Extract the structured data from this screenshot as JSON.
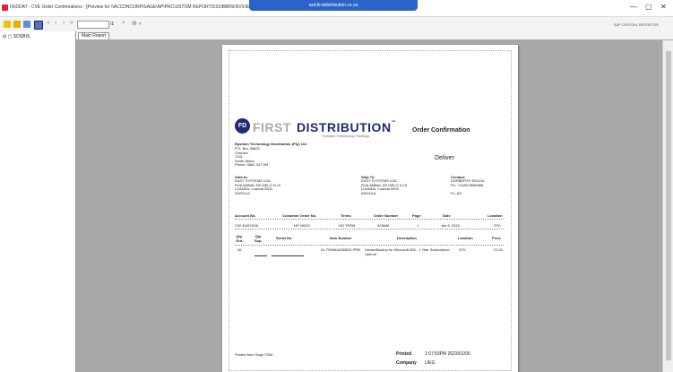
{
  "window": {
    "title": "FEDDAT - CVE Order Confirmations - [Preview for \\\\ACCDNCORP\\SAGE\\AP\\PRC\\USTOM REPORTS\\SOBBR\\ENV\\OECONF01.CPT]",
    "remote_title": "ssd.firstdistribution.co.za",
    "controls": {
      "minimize": "—",
      "maximize": "▢",
      "close": "✕"
    }
  },
  "toolbar": {
    "page_of": "/1",
    "sap_label": "SAP CRYSTAL REPORTS®"
  },
  "tree": {
    "root": "SOSBIS"
  },
  "tabs": [
    "Main Report"
  ],
  "report": {
    "logo": {
      "mark": "FD",
      "first": "FIRST",
      "dist": "DISTRIBUTION",
      "tm": "™",
      "sub": "Epsidon Technology Holdings"
    },
    "title": "Order Confirmation",
    "company": "Epsidon Technology Distribution (Pty) Ltd",
    "company_address": "P.O. Box 38825\nChemex\n7441\nSouth Africa\nPhone: 0861 347763",
    "deliver": "Deliver",
    "sold_to_label": "Sold to:",
    "sold_to": "EASY SYSTEMS LDA\nRUA AMBAL DE MELO N.10\nLUANDA, Luanda 0000\nANGOLA",
    "ship_to_label": "Ship To:",
    "ship_to": "EASY SYSTEMS LDA\nRUA AMBAL DE MELO N.10\nLUANDA, Luanda 0000\nANGOLA",
    "contact_label": "Contact:",
    "contact": "NORBERTO SOUSA\nPh: +244923589868\n\nFx: AO",
    "header_cols": {
      "account": "Account No.",
      "customer_order": "Customer Order No.",
      "terms": "Terms",
      "order_number": "Order Number",
      "page": "Page",
      "date": "Date",
      "location": "Location"
    },
    "header_vals": {
      "account": "C00 EASY006",
      "customer_order": "NP 00003",
      "terms": "NO TERM",
      "order_number": "903686",
      "page": "1",
      "date": "Jan 6, 2023",
      "location": "STK"
    },
    "item_cols": {
      "qty_ord": "Qty.\nOrd.",
      "qty_sup": "Qty.\nSup.",
      "serial": "Serial No.",
      "item_number": "Item Number",
      "description": "Description",
      "location": "Location",
      "price": "Price"
    },
    "item": {
      "qty": "45",
      "item_number": "01-7998AU6365D0-PRB",
      "description": "VeeamBackup for Microsoft 365 - 1 Year Subscription\nUpfront",
      "location": "STK",
      "price": "21.00"
    },
    "footer_left": "Posted from Sage CRM",
    "printed_label": "Printed",
    "printed_value": "1:07:53PM   2023/01/06",
    "company_label": "Company",
    "company_value": "LIEG"
  }
}
